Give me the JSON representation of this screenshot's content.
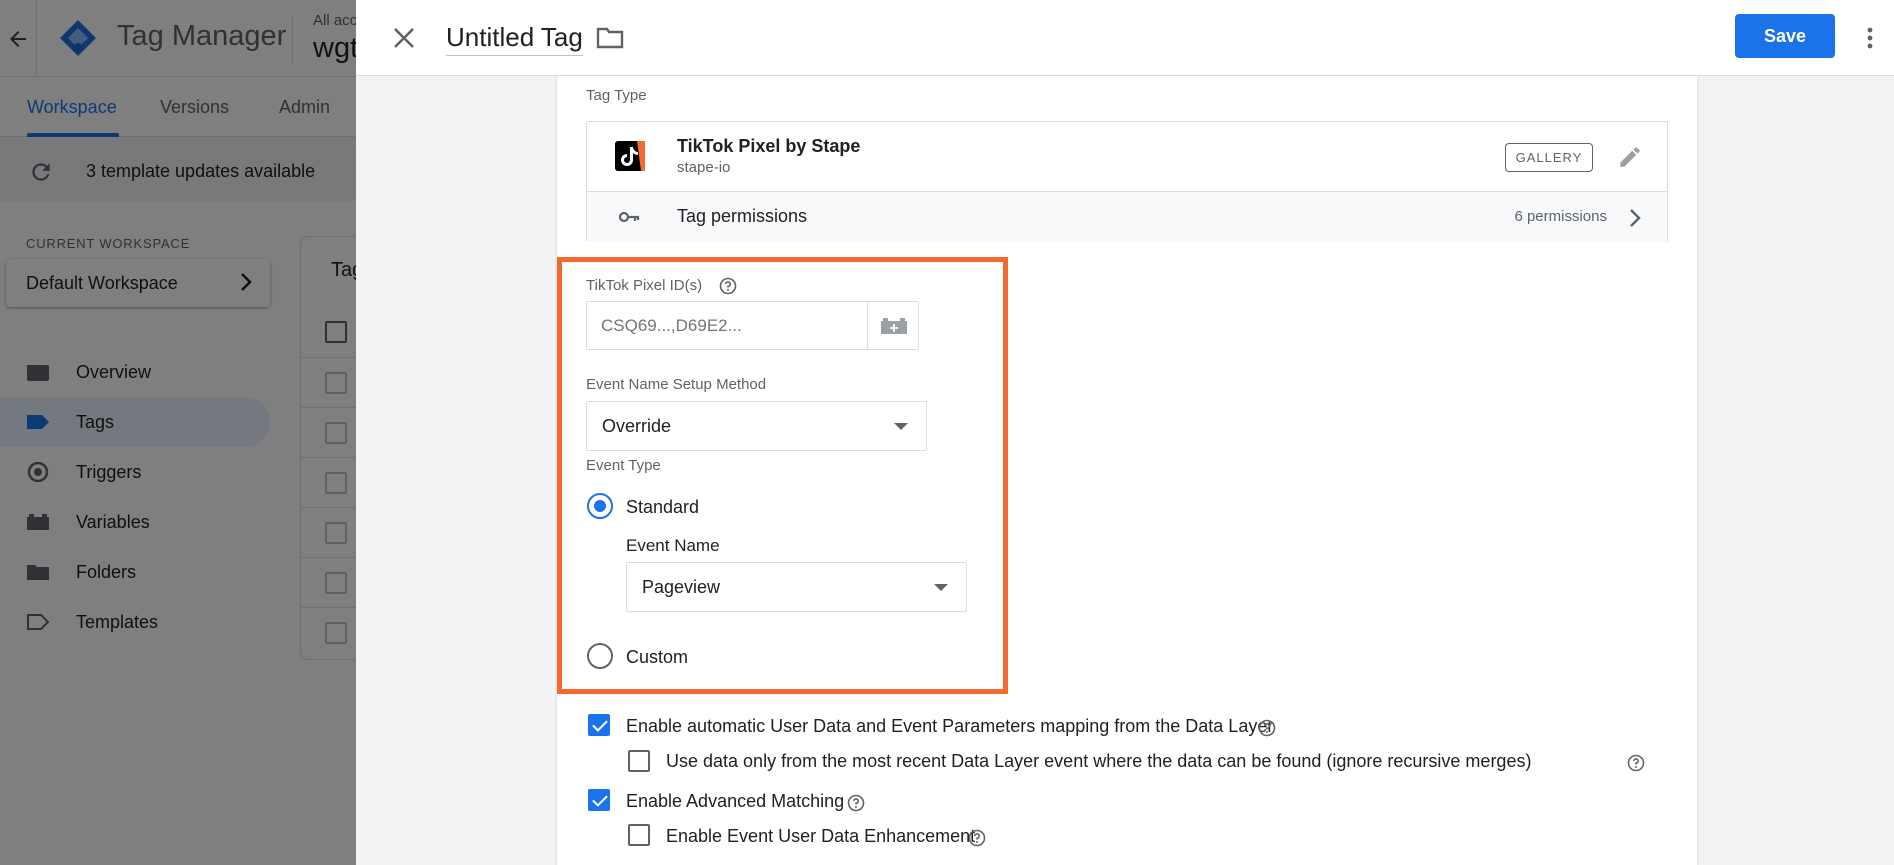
{
  "app": {
    "name": "Tag Manager",
    "account_small": "All acc",
    "account_big": "wgt"
  },
  "nav": {
    "tabs": [
      {
        "label": "Workspace",
        "active": true
      },
      {
        "label": "Versions",
        "active": false
      },
      {
        "label": "Admin",
        "active": false
      }
    ]
  },
  "updates": {
    "text": "3 template updates available"
  },
  "workspace": {
    "label": "CURRENT WORKSPACE",
    "name": "Default Workspace"
  },
  "sidebar": {
    "items": [
      {
        "label": "Overview",
        "icon": "overview-icon",
        "active": false
      },
      {
        "label": "Tags",
        "icon": "tag-icon",
        "active": true
      },
      {
        "label": "Triggers",
        "icon": "trigger-icon",
        "active": false
      },
      {
        "label": "Variables",
        "icon": "variables-icon",
        "active": false
      },
      {
        "label": "Folders",
        "icon": "folder-icon",
        "active": false
      },
      {
        "label": "Templates",
        "icon": "template-icon",
        "active": false
      }
    ]
  },
  "tags_card": {
    "title": "Tag"
  },
  "panel": {
    "title": "Untitled Tag",
    "save_label": "Save"
  },
  "tag_type": {
    "label": "Tag Type",
    "name": "TikTok Pixel by Stape",
    "vendor": "stape-io",
    "gallery_label": "GALLERY",
    "permissions_label": "Tag permissions",
    "permissions_count": "6 permissions"
  },
  "form": {
    "pixel_ids_label": "TikTok Pixel ID(s)",
    "pixel_ids_placeholder": "CSQ69...,D69E2...",
    "event_setup_label": "Event Name Setup Method",
    "event_setup_value": "Override",
    "event_type_label": "Event Type",
    "standard_label": "Standard",
    "event_name_label": "Event Name",
    "event_name_value": "Pageview",
    "custom_label": "Custom"
  },
  "checkboxes": [
    {
      "label": "Enable automatic User Data and Event Parameters mapping from the Data Layer",
      "checked": true
    },
    {
      "label": "Use data only from the most recent Data Layer event where the data can be found (ignore recursive merges)",
      "checked": false
    },
    {
      "label": "Enable Advanced Matching",
      "checked": true
    },
    {
      "label": "Enable Event User Data Enhancement",
      "checked": false
    }
  ],
  "colors": {
    "accent": "#1a73e8",
    "highlight": "#f4692f"
  }
}
